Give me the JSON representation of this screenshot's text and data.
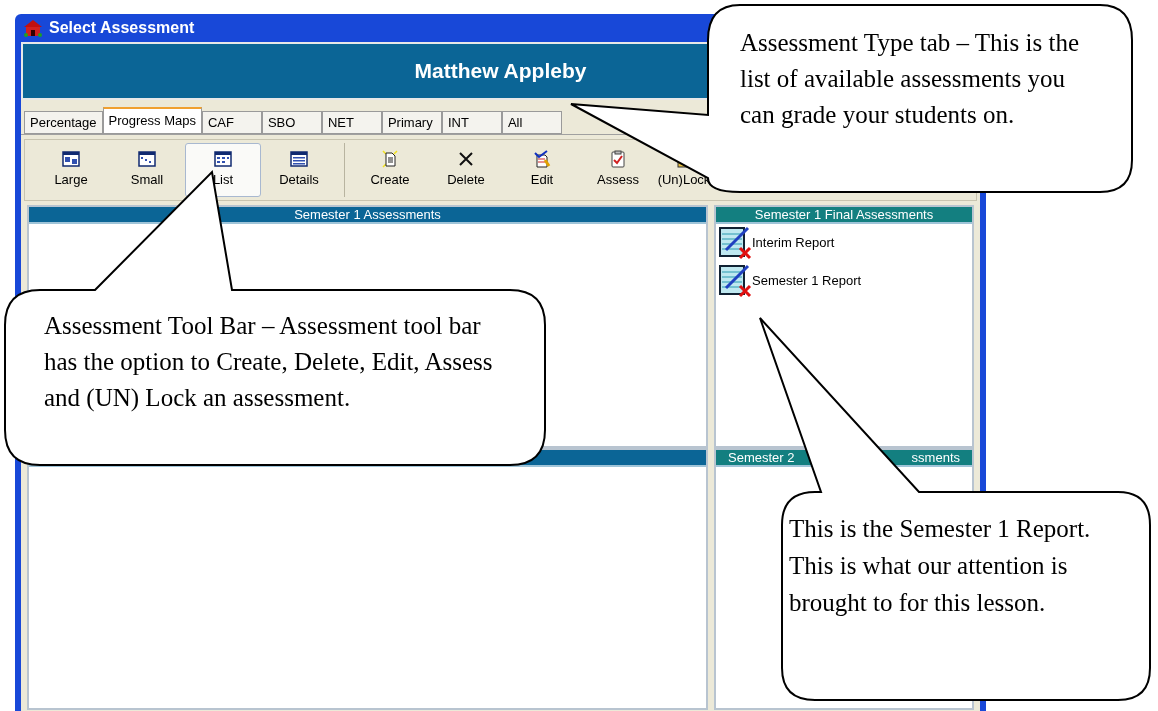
{
  "window": {
    "title": "Select Assessment"
  },
  "student_name": "Matthew Appleby",
  "tabs": [
    {
      "label": "Percentage",
      "selected": false
    },
    {
      "label": "Progress Maps",
      "selected": true
    },
    {
      "label": "CAF",
      "selected": false
    },
    {
      "label": "SBO",
      "selected": false
    },
    {
      "label": "NET",
      "selected": false
    },
    {
      "label": "Primary",
      "selected": false
    },
    {
      "label": "INT",
      "selected": false
    },
    {
      "label": "All",
      "selected": false
    }
  ],
  "toolbar": [
    {
      "label": "Large",
      "selected": false
    },
    {
      "label": "Small",
      "selected": false
    },
    {
      "label": "List",
      "selected": true
    },
    {
      "label": "Details",
      "selected": false
    },
    {
      "label": "Create",
      "selected": false
    },
    {
      "label": "Delete",
      "selected": false
    },
    {
      "label": "Edit",
      "selected": false
    },
    {
      "label": "Assess",
      "selected": false
    },
    {
      "label": "(Un)Lock",
      "selected": false
    }
  ],
  "panels_top": [
    {
      "title": "Semester 1 Assessments"
    },
    {
      "title": "Semester 1 Final Assessments",
      "items": [
        "Interim Report",
        "Semester 1 Report"
      ]
    }
  ],
  "panels_bottom": [
    {
      "title_parts": [
        "Semester 2",
        "ssments"
      ]
    }
  ],
  "callouts": [
    "Assessment Type tab – This is the list of available assessments you can grade your students on.",
    "Assessment Tool Bar – Assessment tool bar has the option to Create, Delete, Edit, Assess and (UN) Lock an assessment.",
    "This is the Semester 1 Report. This is what our attention is brought to for this lesson."
  ]
}
